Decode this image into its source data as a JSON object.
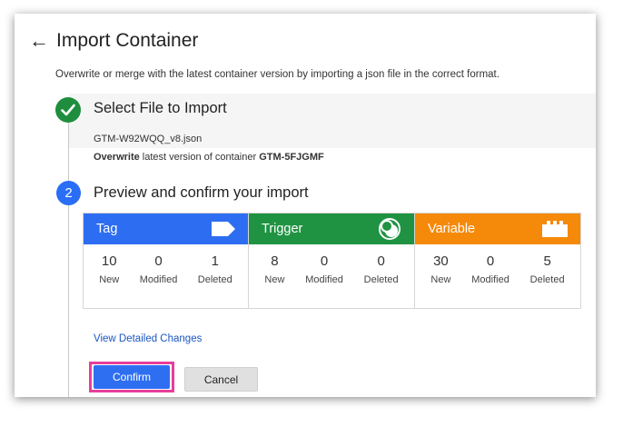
{
  "header": {
    "back_icon": "left-arrow-icon",
    "title": "Import Container"
  },
  "description": "Overwrite or merge with the latest container version by importing a json file in the correct format.",
  "step1": {
    "title": "Select File to Import",
    "filename": "GTM-W92WQQ_v8.json",
    "overwrite_prefix": "Overwrite",
    "overwrite_middle": " latest version of container ",
    "container_id": "GTM-5FJGMF"
  },
  "step2": {
    "number": "2",
    "title": "Preview and confirm your import",
    "cards": [
      {
        "label": "Tag",
        "color": "#2d6df2",
        "icon": "tag-icon",
        "stats": [
          {
            "n": "10",
            "l": "New"
          },
          {
            "n": "0",
            "l": "Modified"
          },
          {
            "n": "1",
            "l": "Deleted"
          }
        ]
      },
      {
        "label": "Trigger",
        "color": "#1f9342",
        "icon": "trigger-icon",
        "stats": [
          {
            "n": "8",
            "l": "New"
          },
          {
            "n": "0",
            "l": "Modified"
          },
          {
            "n": "0",
            "l": "Deleted"
          }
        ]
      },
      {
        "label": "Variable",
        "color": "#f5890a",
        "icon": "variable-icon",
        "stats": [
          {
            "n": "30",
            "l": "New"
          },
          {
            "n": "0",
            "l": "Modified"
          },
          {
            "n": "5",
            "l": "Deleted"
          }
        ]
      }
    ],
    "view_changes": "View Detailed Changes"
  },
  "actions": {
    "confirm": "Confirm",
    "cancel": "Cancel"
  }
}
